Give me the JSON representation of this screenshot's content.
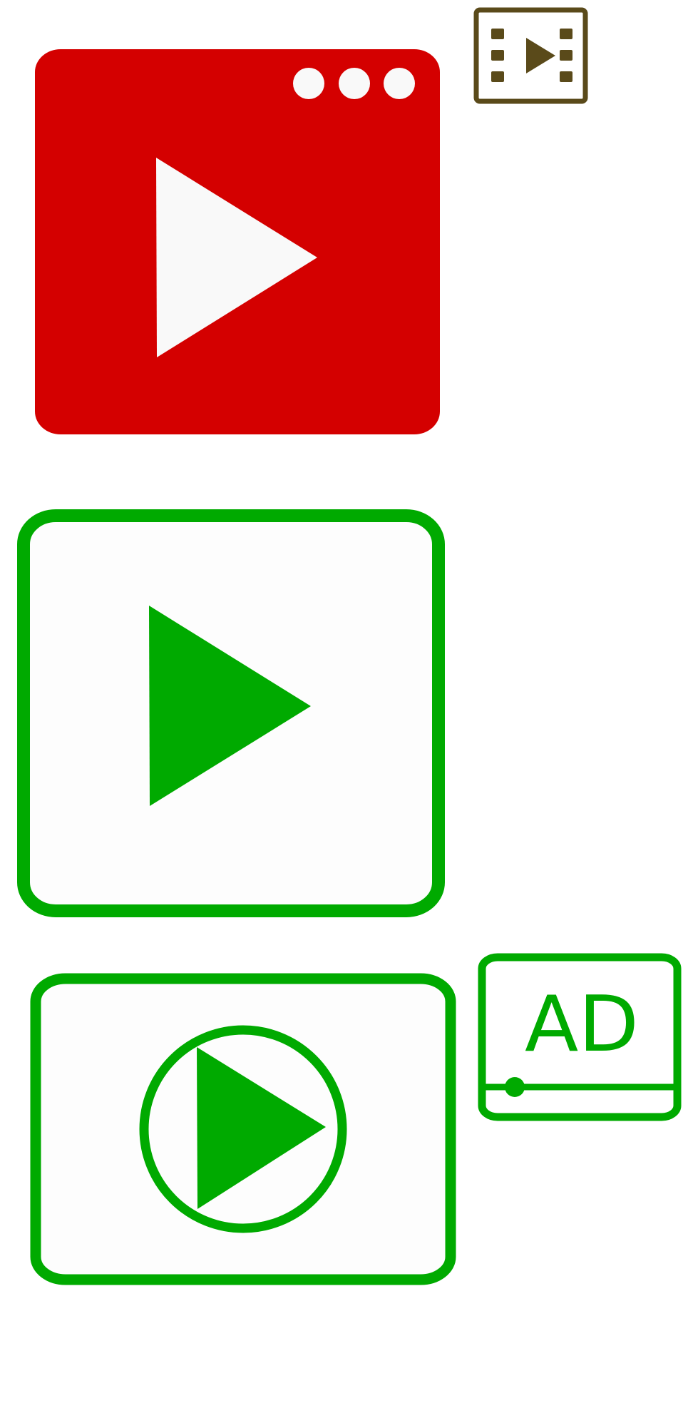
{
  "colors": {
    "red_fill": "#d40000",
    "white_glyph": "#f9f9f9",
    "green": "#00aa00",
    "brown": "#5a4a1a",
    "panel_fill": "#fdfdfd"
  },
  "icons": [
    {
      "name": "red-video-player-icon"
    },
    {
      "name": "film-strip-play-icon"
    },
    {
      "name": "green-outline-play-icon"
    },
    {
      "name": "green-circle-play-icon"
    },
    {
      "name": "ad-video-icon"
    }
  ],
  "ad_icon": {
    "label": "AD"
  }
}
